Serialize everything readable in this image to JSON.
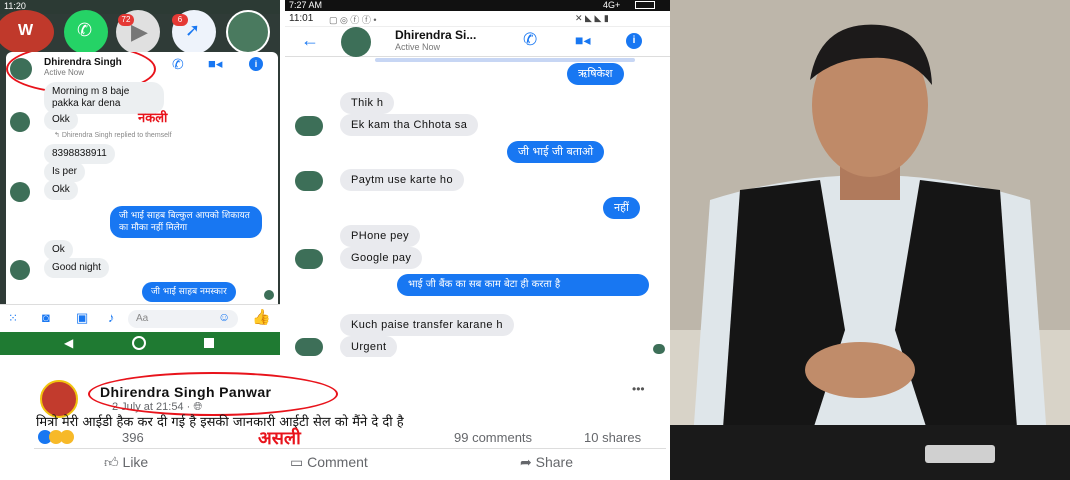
{
  "left_phone": {
    "status_time": "11:20",
    "badge_messages": "72",
    "badge_messenger": "6",
    "contact_name": "Dhirendra Singh",
    "contact_status": "Active Now",
    "messages": [
      {
        "dir": "in",
        "text": "Morning m 8 baje pakka kar dena"
      },
      {
        "dir": "in",
        "text": "Okk"
      },
      {
        "dir": "note",
        "text": "Dhirendra Singh replied to themself"
      },
      {
        "dir": "in",
        "text": "8398838911"
      },
      {
        "dir": "in",
        "text": "Is per"
      },
      {
        "dir": "in",
        "text": "Okk"
      },
      {
        "dir": "out",
        "text": "जी भाई साहब बिल्कुल आपको शिकायत का मौका नहीं मिलेगा"
      },
      {
        "dir": "in",
        "text": "Ok"
      },
      {
        "dir": "in",
        "text": "Good night"
      },
      {
        "dir": "out",
        "text": "जी भाई साहब नमस्कार"
      }
    ],
    "input_placeholder": "Aa",
    "annotation": "नकली"
  },
  "mid_phone": {
    "status_time": "7:27 AM",
    "status_network": "4G+",
    "status_time2": "11:01",
    "contact_name": "Dhirendra Si...",
    "contact_status": "Active Now",
    "messages": [
      {
        "dir": "out",
        "text": "ऋषिकेश"
      },
      {
        "dir": "in",
        "text": "Thik h"
      },
      {
        "dir": "in",
        "text": "Ek kam tha Chhota sa"
      },
      {
        "dir": "out",
        "text": "जी भाई जी बताओ"
      },
      {
        "dir": "in",
        "text": "Paytm use karte ho"
      },
      {
        "dir": "out",
        "text": "नहीं"
      },
      {
        "dir": "in",
        "text": "PHone pey"
      },
      {
        "dir": "in",
        "text": "Google pay"
      },
      {
        "dir": "out",
        "text": "भाई जी बैंक का सब काम बेटा ही करता है"
      },
      {
        "dir": "in",
        "text": "Kuch paise transfer karane h"
      },
      {
        "dir": "in",
        "text": "Urgent"
      }
    ]
  },
  "fb_post": {
    "author": "Dhirendra Singh Panwar",
    "meta": "2 July at 21:54 · ",
    "more": "•••",
    "text": "मित्रो मेरी आईडी हैक कर दी गई है इसकी जानकारी आईटी सेल को मैंने  दे दी है",
    "reaction_count": "396",
    "comments": "99 comments",
    "shares": "10 shares",
    "like_label": "Like",
    "comment_label": "Comment",
    "share_label": "Share",
    "annotation": "असली"
  },
  "colors": {
    "messenger_blue": "#1877f2",
    "annotation_red": "#e8131b"
  }
}
